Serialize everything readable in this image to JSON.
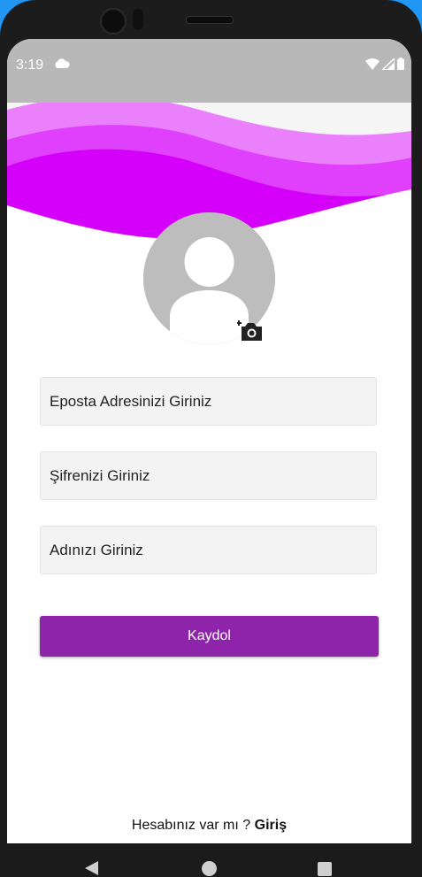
{
  "status_bar": {
    "time": "3:19"
  },
  "form": {
    "email_placeholder": "Eposta Adresinizi Giriniz",
    "password_placeholder": "Şifrenizi Giriniz",
    "name_placeholder": "Adınızı Giriniz",
    "submit_label": "Kaydol"
  },
  "footer": {
    "question": "Hesabınız var mı ?",
    "login_link": "Giriş"
  },
  "colors": {
    "accent": "#8e24aa",
    "wave_dark": "#d500f9",
    "wave_mid": "#e040fb",
    "wave_light": "#ea80fc",
    "status_bar": "#b8b8b8"
  },
  "icons": {
    "status": [
      "cloud-icon",
      "wifi-icon",
      "signal-icon",
      "battery-icon"
    ],
    "avatar": "person-icon",
    "add_photo": "add-a-photo-icon",
    "nav": [
      "back-icon",
      "home-icon",
      "recent-apps-icon"
    ]
  }
}
